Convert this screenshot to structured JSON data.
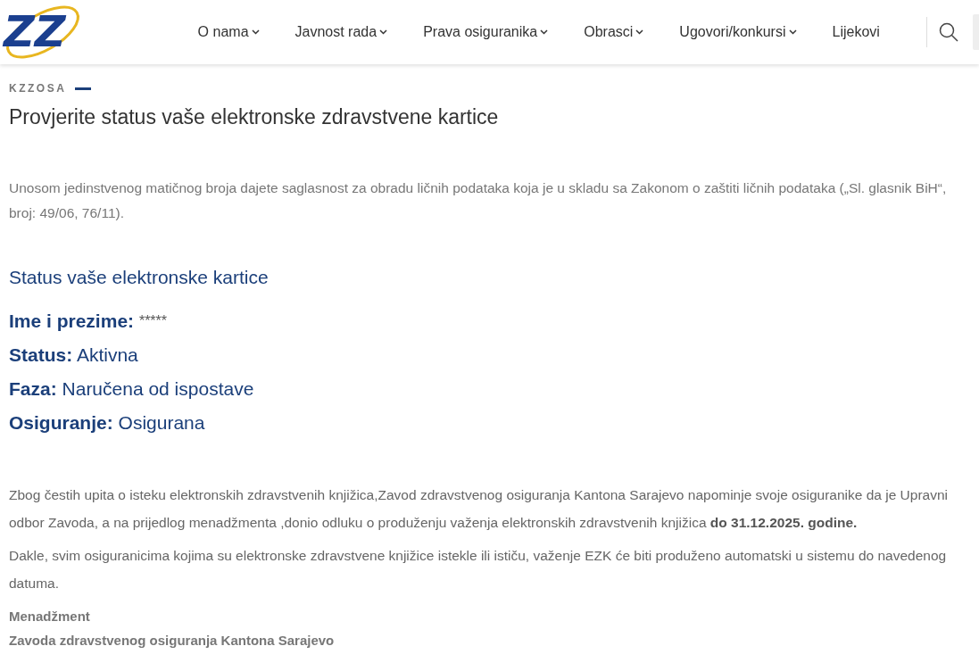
{
  "header": {
    "logo": "ZZ",
    "nav": [
      {
        "label": "O nama",
        "dropdown": true
      },
      {
        "label": "Javnost rada",
        "dropdown": true
      },
      {
        "label": "Prava osiguranika",
        "dropdown": true
      },
      {
        "label": "Obrasci",
        "dropdown": true
      },
      {
        "label": "Ugovori/konkursi",
        "dropdown": true
      },
      {
        "label": "Lijekovi",
        "dropdown": false
      }
    ]
  },
  "eyebrow": "KZZOSA",
  "title": "Provjerite status vaše elektronske zdravstvene kartice",
  "consent": "Unosom jedinstvenog matičnog broja dajete saglasnost za obradu ličnih podataka koja je u skladu sa Zakonom o zaštiti ličnih podataka („Sl. glasnik BiH“, broj: 49/06, 76/11).",
  "status_heading": "Status vaše elektronske kartice",
  "fields": [
    {
      "label": "Ime i prezime:",
      "value": "*****"
    },
    {
      "label": "Status:",
      "value": "Aktivna"
    },
    {
      "label": "Faza:",
      "value": "Naručena od ispostave"
    },
    {
      "label": "Osiguranje:",
      "value": "Osigurana"
    }
  ],
  "notice": [
    "Zbog čestih upita o isteku elektronskih zdravstvenih knjižica,Zavod zdravstvenog osiguranja Kantona Sarajevo napominje svoje osiguranike da je Upravni odbor Zavoda, a na prijedlog menadžmenta ,donio odluku o produženju važenja elektronskih zdravstvenih knjižica **do 31.12.2025. godine.**",
    "Dakle, svim osiguranicima kojima su elektronske zdravstvene knjižice istekle ili ističu, važenje EZK će biti produženo automatski u sistemu do navedenog datuma."
  ],
  "signature": [
    "Menadžment",
    "Zavoda zdravstvenog osiguranja Kantona Sarajevo"
  ]
}
